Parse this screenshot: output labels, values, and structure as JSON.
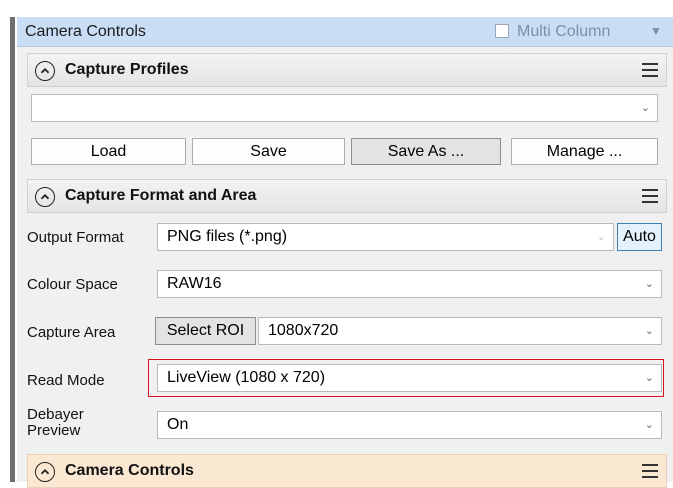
{
  "panel": {
    "title": "Camera Controls",
    "multi_column_label": "Multi Column",
    "multi_column_checked": false
  },
  "capture_profiles": {
    "title": "Capture Profiles",
    "selected": "",
    "buttons": {
      "load": "Load",
      "save": "Save",
      "save_as": "Save As ...",
      "manage": "Manage ..."
    }
  },
  "capture_format": {
    "title": "Capture Format and Area",
    "output_format": {
      "label": "Output Format",
      "value": "PNG files (*.png)",
      "auto_label": "Auto"
    },
    "colour_space": {
      "label": "Colour Space",
      "value": "RAW16"
    },
    "capture_area": {
      "label": "Capture Area",
      "select_roi_label": "Select ROI",
      "value": "1080x720"
    },
    "read_mode": {
      "label": "Read Mode",
      "value": "LiveView (1080 x 720)"
    },
    "debayer_preview": {
      "label_line1": "Debayer",
      "label_line2": "Preview",
      "value": "On"
    }
  },
  "camera_controls": {
    "title": "Camera Controls"
  },
  "colors": {
    "title_bar": "#c9def5",
    "highlight_border": "#d8131b",
    "camera_controls_header": "#fbe8d3"
  }
}
